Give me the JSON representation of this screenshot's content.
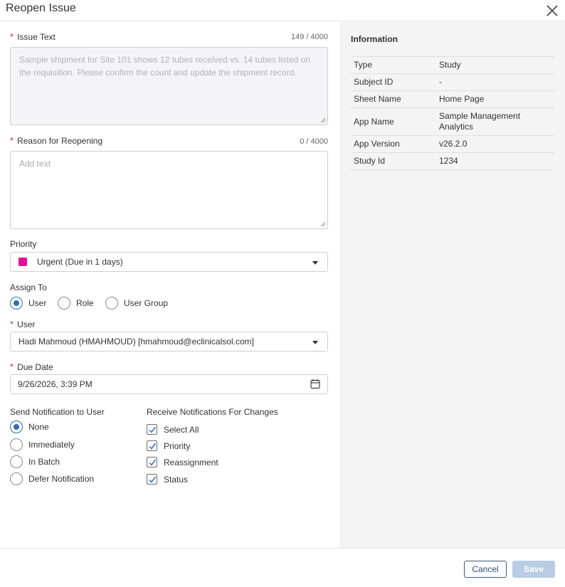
{
  "dialog": {
    "title": "Reopen Issue"
  },
  "form": {
    "issue_text": {
      "label": "Issue Text",
      "counter": "149 / 4000",
      "value": "Sample shipment for Site 101 shows 12 tubes received vs. 14 tubes listed on the requisition. Please confirm the count and update the shipment record."
    },
    "reason": {
      "label": "Reason for Reopening",
      "counter": "0 / 4000",
      "placeholder": "Add text"
    },
    "priority": {
      "label": "Priority",
      "value": "Urgent (Due in 1 days)",
      "color": "#e0109b"
    },
    "assign_to": {
      "label": "Assign To",
      "options": [
        "User",
        "Role",
        "User Group"
      ],
      "selected": "User"
    },
    "user": {
      "label": "User",
      "value": "Hadi Mahmoud (HMAHMOUD) [hmahmoud@eclinicalsol.com]"
    },
    "due_date": {
      "label": "Due Date",
      "value": "9/26/2026, 3:39 PM"
    },
    "send_notification": {
      "label": "Send Notification to User",
      "options": [
        "None",
        "Immediately",
        "In Batch",
        "Defer Notification"
      ],
      "selected": "None"
    },
    "receive_notifications": {
      "label": "Receive Notifications For Changes",
      "options": [
        "Select All",
        "Priority",
        "Reassignment",
        "Status"
      ],
      "checked": [
        true,
        true,
        true,
        true
      ]
    }
  },
  "info": {
    "title": "Information",
    "rows": [
      {
        "key": "Type",
        "value": "Study"
      },
      {
        "key": "Subject ID",
        "value": "-"
      },
      {
        "key": "Sheet Name",
        "value": "Home Page"
      },
      {
        "key": "App Name",
        "value": "Sample Management Analytics"
      },
      {
        "key": "App Version",
        "value": "v26.2.0"
      },
      {
        "key": "Study Id",
        "value": "1234"
      }
    ]
  },
  "footer": {
    "cancel_label": "Cancel",
    "save_label": "Save"
  },
  "colors": {
    "accent": "#2e6db4",
    "required": "#c0392b",
    "save_disabled": "#b8cce4"
  }
}
